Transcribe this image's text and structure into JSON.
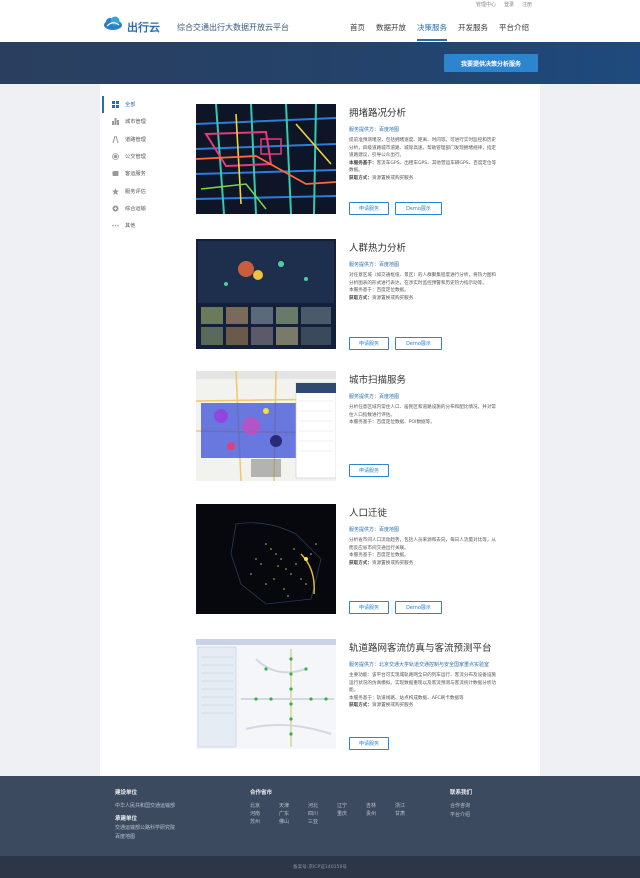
{
  "top_links": [
    "管理中心",
    "登录",
    "注册"
  ],
  "header": {
    "brand": "出行云",
    "tagline": "综合交通出行大数据开放云平台",
    "nav": [
      "首页",
      "数据开放",
      "决策服务",
      "开发服务",
      "平台介绍"
    ],
    "nav_active": "决策服务"
  },
  "banner": {
    "button": "我要提供决策分析服务"
  },
  "sidebar": {
    "items": [
      {
        "label": "全部",
        "icon": "grid-icon"
      },
      {
        "label": "城市管理",
        "icon": "city-icon"
      },
      {
        "label": "道路管理",
        "icon": "road-icon"
      },
      {
        "label": "公交管理",
        "icon": "bus-icon"
      },
      {
        "label": "客运服务",
        "icon": "passenger-icon"
      },
      {
        "label": "服务评估",
        "icon": "star-icon"
      },
      {
        "label": "综合运输",
        "icon": "transport-icon"
      },
      {
        "label": "其他",
        "icon": "dots-icon"
      }
    ]
  },
  "services": [
    {
      "title": "拥堵路况分析",
      "provider": "服务提供方：百度地图",
      "lines": [
        {
          "text": "提前准预测堵况，包括拥堵速度、距离、时间等。可进行实时监控和历史分析，四级道路城市道路、城际高速。帮助管理部门发现拥堵规律，指定道路建议，引导公众出行。"
        },
        {
          "label": "本服务基于：",
          "text": "客流车GPS、出租车GPS、其他营运车辆GPS、百度定位等数据。"
        },
        {
          "label": "获取方式：",
          "text": "资源置换或购买服务"
        }
      ],
      "buttons": [
        "申请服务",
        "Demo展示"
      ]
    },
    {
      "title": "人群热力分析",
      "provider": "服务提供方：百度地图",
      "lines": [
        {
          "text": "对任意区域（如交通枢纽、景区）的人群聚集程度进行分析，将热力图和分析图表的形式进行表达，在涉实时监控预警和历史热力指示动等。"
        },
        {
          "text": "本服务基于：百度定位数据。"
        },
        {
          "label": "获取方式：",
          "text": "资源置换或购买服务"
        }
      ],
      "buttons": [
        "申请服务",
        "Demo展示"
      ]
    },
    {
      "title": "城市扫描服务",
      "provider": "服务提供方：百度地图",
      "lines": [
        {
          "text": "分析任意区域内常住人口、居民区和道路设施的分布和配比情况，并对常住人口指数进行评估。"
        },
        {
          "text": "本服务基于：百度定位数据、POI数据等。"
        }
      ],
      "buttons": [
        "申请服务"
      ]
    },
    {
      "title": "人口迁徙",
      "provider": "服务提供方：百度地图",
      "lines": [
        {
          "text": "分析省市间人口流动趋势，包括人员来源和去向，每日人流量对比等，从而反应省市间交通出行关联。"
        },
        {
          "text": "本服务基于：百度定位数据。"
        },
        {
          "label": "获取方式：",
          "text": "资源置换或购买服务"
        }
      ],
      "buttons": [
        "申请服务",
        "Demo展示"
      ]
    },
    {
      "title": "轨道路网客流仿真与客流预测平台",
      "provider": "服务提供方：北京交通大学轨道交通控制与安全国家重点实验室",
      "lines": [
        {
          "text": "主要功能：该平台可实现城轨路网全日的列车运行、客流分布及设备设施运行状况的仿真模拟。实现数据重现以及客流预测与客流统计数据分析功能。"
        },
        {
          "text": "本服务基于：轨道线路、站点构成数据、AFC刷卡数据等"
        },
        {
          "label": "获取方式：",
          "text": "资源置换或购买服务"
        }
      ],
      "buttons": [
        "申请服务"
      ]
    }
  ],
  "footer": {
    "col1": {
      "heading": "建设单位",
      "items": [
        "中华人民共和国交通运输部"
      ],
      "heading2": "承建单位",
      "items2": [
        "交通运输部公路科学研究院",
        "百度地图"
      ]
    },
    "col2": {
      "heading": "合作省市",
      "cities": [
        "北京",
        "天津",
        "河北",
        "辽宁",
        "吉林",
        "浙江",
        "河南",
        "广东",
        "四川",
        "重庆",
        "贵州",
        "甘肃",
        "苏州",
        "佛山",
        "三亚"
      ]
    },
    "col3": {
      "heading": "联系我们",
      "items": [
        "合作咨询",
        "平台介绍"
      ]
    },
    "copyright": "备案号:京ICP证140158号"
  },
  "colors": {
    "accent": "#2b6ea7",
    "button": "#2d84cf",
    "banner": "#24426a",
    "footer": "#3c4a5f"
  }
}
